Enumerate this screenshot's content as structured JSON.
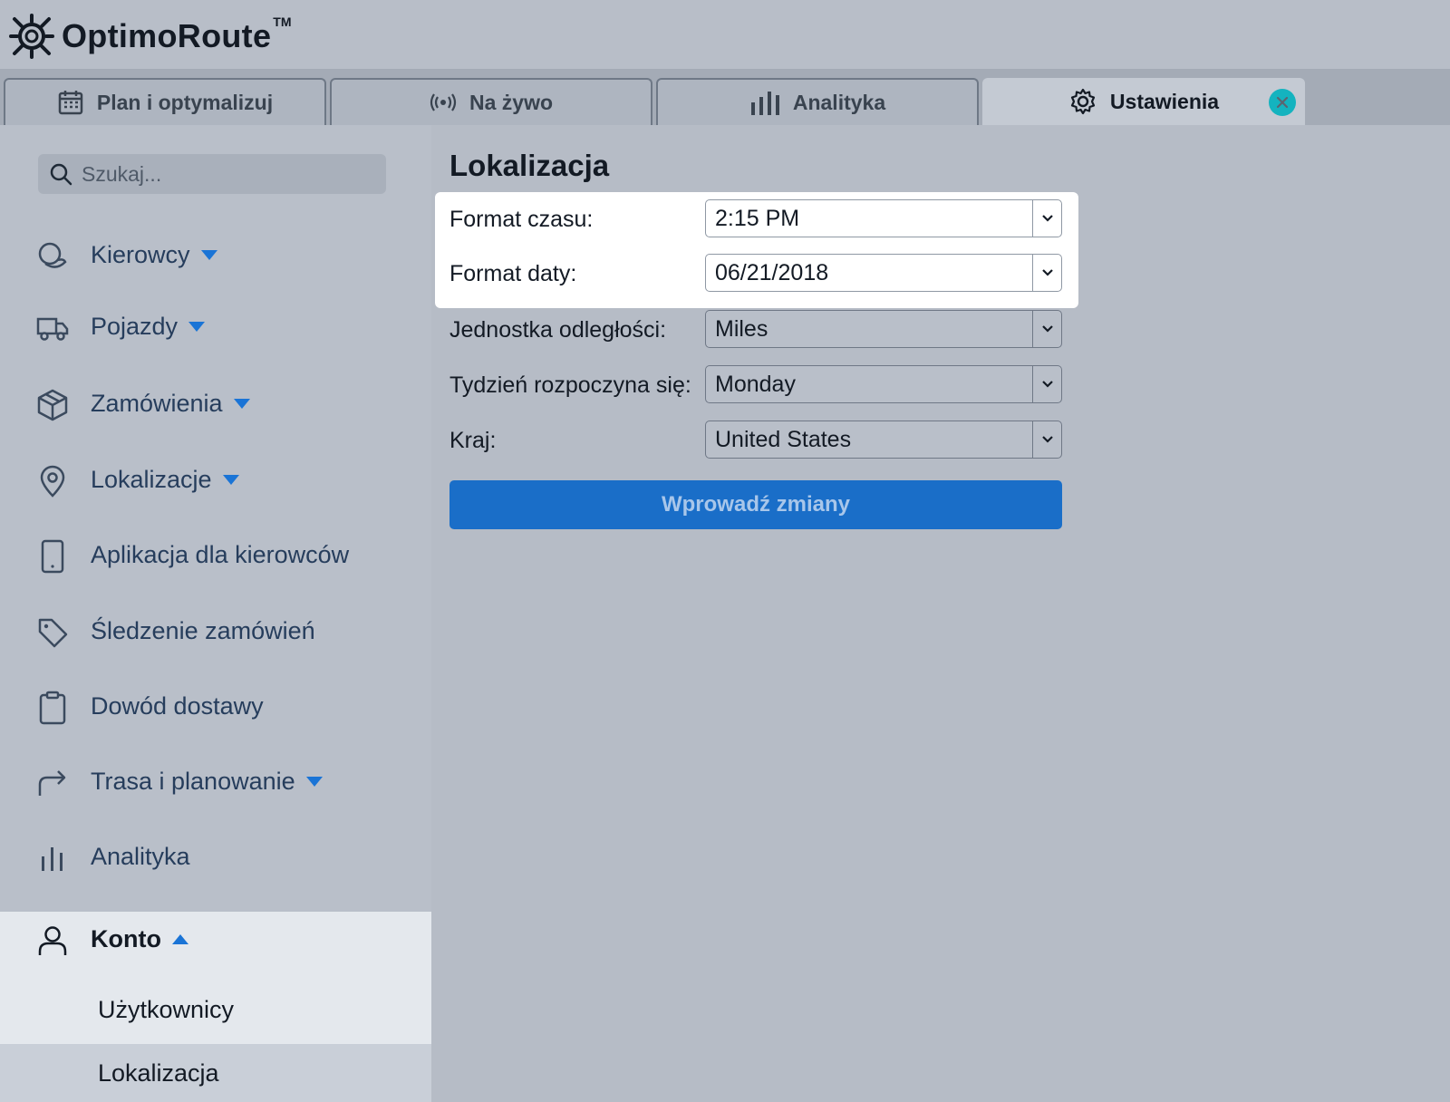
{
  "app": {
    "logo_text": "OptimoRoute",
    "logo_tm": "TM"
  },
  "tabs": [
    {
      "label": "Plan i optymalizuj",
      "icon": "calendar-icon"
    },
    {
      "label": "Na żywo",
      "icon": "live-signal-icon"
    },
    {
      "label": "Analityka",
      "icon": "bar-chart-icon"
    },
    {
      "label": "Ustawienia",
      "icon": "gear-icon",
      "active": true
    }
  ],
  "sidebar": {
    "search_placeholder": "Szukaj...",
    "items": [
      {
        "label": "Kierowcy",
        "icon": "drivers-icon",
        "expandable": true
      },
      {
        "label": "Pojazdy",
        "icon": "truck-icon",
        "expandable": true
      },
      {
        "label": "Zamówienia",
        "icon": "package-icon",
        "expandable": true
      },
      {
        "label": "Lokalizacje",
        "icon": "location-pin-icon",
        "expandable": true
      },
      {
        "label": "Aplikacja dla kierowców",
        "icon": "mobile-icon",
        "expandable": false
      },
      {
        "label": "Śledzenie zamówień",
        "icon": "tag-icon",
        "expandable": false
      },
      {
        "label": "Dowód dostawy",
        "icon": "clipboard-icon",
        "expandable": false
      },
      {
        "label": "Trasa i planowanie",
        "icon": "route-arrow-icon",
        "expandable": true
      },
      {
        "label": "Analityka",
        "icon": "bar-chart-icon",
        "expandable": false
      }
    ],
    "account": {
      "label": "Konto",
      "icon": "user-icon",
      "expanded": true,
      "subitems": [
        {
          "label": "Użytkownicy",
          "active": false
        },
        {
          "label": "Lokalizacja",
          "active": true
        }
      ]
    }
  },
  "main": {
    "title": "Lokalizacja",
    "fields": [
      {
        "label": "Format czasu:",
        "value": "2:15 PM"
      },
      {
        "label": "Format daty:",
        "value": "06/21/2018"
      },
      {
        "label": "Jednostka odległości:",
        "value": "Miles"
      },
      {
        "label": "Tydzień rozpoczyna się:",
        "value": "Monday"
      },
      {
        "label": "Kraj:",
        "value": "United States"
      }
    ],
    "submit_label": "Wprowadź zmiany"
  },
  "colors": {
    "accent": "#1a6ec8",
    "close_badge": "#14b3bf"
  }
}
